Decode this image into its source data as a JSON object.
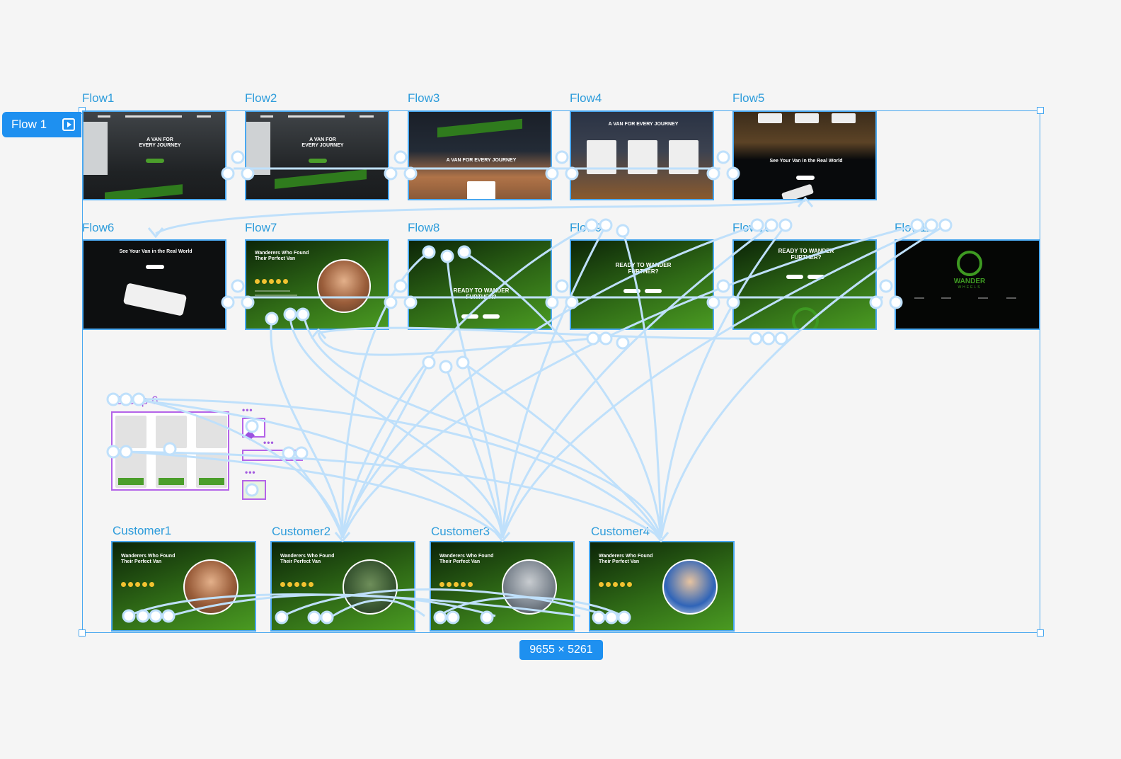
{
  "frame_tag": {
    "label": "Flow 1",
    "icon": "prototype-play-icon"
  },
  "size_badge": "9655 × 5261",
  "frames": {
    "flow1": {
      "label": "Flow1",
      "heading": "A VAN FOR\nEVERY JOURNEY"
    },
    "flow2": {
      "label": "Flow2",
      "heading": "A VAN FOR\nEVERY JOURNEY"
    },
    "flow3": {
      "label": "Flow3",
      "heading": "A VAN FOR EVERY JOURNEY"
    },
    "flow4": {
      "label": "Flow4",
      "heading": "A VAN FOR EVERY JOURNEY"
    },
    "flow5": {
      "label": "Flow5",
      "heading": "See Your Van in the Real World"
    },
    "flow6": {
      "label": "Flow6",
      "heading": "See Your Van in the Real World"
    },
    "flow7": {
      "label": "Flow7",
      "heading": "Wanderers Who Found\nTheir Perfect Van"
    },
    "flow8": {
      "label": "Flow8",
      "heading": "READY TO WANDER\nFURTHER?"
    },
    "flow9": {
      "label": "Flow9",
      "heading": "READY TO WANDER\nFURTHER?"
    },
    "flow10": {
      "label": "Flow10",
      "heading": "READY TO WANDER\nFURTHER?"
    },
    "flow11": {
      "label": "Flow11",
      "brand": "WANDER",
      "brand_sub": "WHEELS"
    },
    "group6": {
      "label": "Group 6"
    },
    "customer1": {
      "label": "Customer1",
      "heading": "Wanderers Who Found\nTheir Perfect Van"
    },
    "customer2": {
      "label": "Customer2",
      "heading": "Wanderers Who Found\nTheir Perfect Van"
    },
    "customer3": {
      "label": "Customer3",
      "heading": "Wanderers Who Found\nTheir Perfect Van"
    },
    "customer4": {
      "label": "Customer4",
      "heading": "Wanderers Who Found\nTheir Perfect Van"
    }
  },
  "colors": {
    "selection": "#4aa8f0",
    "wire": "#bfe0fb",
    "component": "#b463e8",
    "accent_green": "#4b9e2b"
  }
}
